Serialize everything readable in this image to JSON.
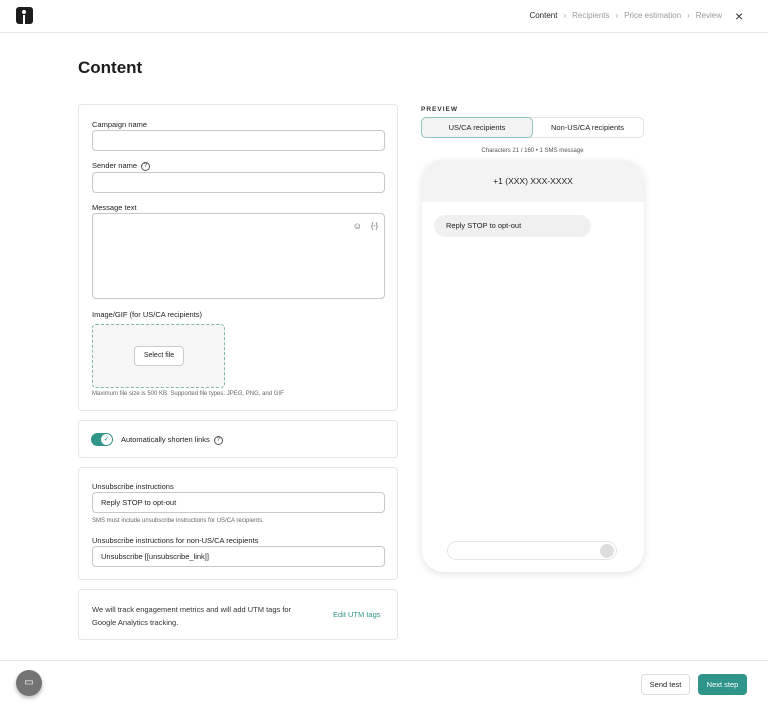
{
  "header": {
    "steps": [
      "Content",
      "Recipients",
      "Price estimation",
      "Review"
    ],
    "active_step": "Content",
    "separator": "›",
    "close_icon": "×"
  },
  "page_title": "Content",
  "form": {
    "campaign_name": {
      "label": "Campaign name",
      "value": ""
    },
    "sender_name": {
      "label": "Sender name",
      "value": "",
      "help_icon": "?"
    },
    "message_text": {
      "label": "Message text",
      "value": "",
      "emoji_icon": "☺",
      "variable_icon": "{-}"
    },
    "image": {
      "label": "Image/GIF (for US/CA recipients)",
      "select_file": "Select file",
      "note": "Maximum file size is 500 KB. Supported file types: JPEG, PNG, and GIF"
    },
    "shorten_links": {
      "label": "Automatically shorten links",
      "enabled": true,
      "help_icon": "?"
    },
    "unsubscribe": {
      "label": "Unsubscribe instructions",
      "value": "Reply STOP to opt-out",
      "hint": "SMS must include unsubscribe instructions for US/CA recipients."
    },
    "unsubscribe_non_us": {
      "label": "Unsubscribe instructions for non-US/CA recipients",
      "value": "Unsubscribe [[unsubscribe_link]]"
    },
    "utm": {
      "text": "We will track engagement metrics and will add UTM tags for Google Analytics tracking.",
      "edit": "Edit UTM tags"
    }
  },
  "preview": {
    "label": "PREVIEW",
    "tabs": [
      "US/CA recipients",
      "Non-US/CA recipients"
    ],
    "active_tab": "US/CA recipients",
    "counter": "Characters 21 / 160 • 1 SMS message",
    "phone_number": "+1 (XXX) XXX-XXXX",
    "message": "Reply STOP to opt-out"
  },
  "footer": {
    "send_test": "Send test",
    "next_step": "Next step"
  },
  "colors": {
    "accent": "#2f958a"
  }
}
